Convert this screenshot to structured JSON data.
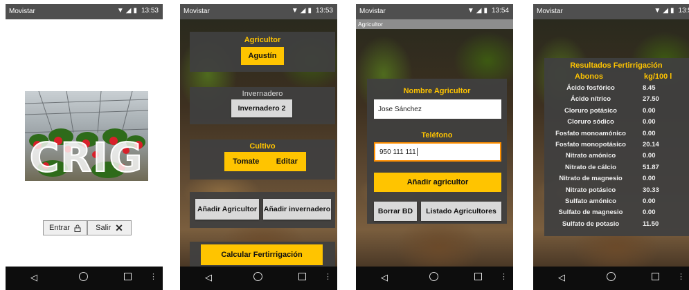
{
  "screen1": {
    "status": {
      "carrier": "Movistar",
      "time": "13:53"
    },
    "logo_text": "CRIG",
    "enter_label": "Entrar",
    "exit_label": "Salir"
  },
  "screen2": {
    "status": {
      "carrier": "Movistar",
      "time": "13:53"
    },
    "farmer_label": "Agricultor",
    "farmer_value": "Agustín",
    "greenhouse_label": "Invernadero",
    "greenhouse_value": "Invernadero 2",
    "crop_label": "Cultivo",
    "crop_value": "Tomate",
    "edit_label": "Editar",
    "add_farmer_label": "Añadir Agricultor",
    "add_greenhouse_label": "Añadir invernadero",
    "calc_label": "Calcular Fertirrigación"
  },
  "screen3": {
    "status": {
      "carrier": "Movistar",
      "time": "13:54"
    },
    "window_title": "Agricultor",
    "name_label": "Nombre Agricultor",
    "name_value": "Jose Sánchez",
    "phone_label": "Teléfono",
    "phone_value": "950 111 111",
    "add_label": "Añadir agricultor",
    "delete_db_label": "Borrar BD",
    "list_label": "Listado Agricultores"
  },
  "screen4": {
    "status": {
      "carrier": "Movistar",
      "time": "13:5"
    },
    "title": "Resultados Fertirrigación",
    "col_fertilizer": "Abonos",
    "col_unit": "kg/100 l",
    "rows": [
      {
        "name": "Ácido fosfórico",
        "value": "8.45"
      },
      {
        "name": "Ácido nítrico",
        "value": "27.50"
      },
      {
        "name": "Cloruro potásico",
        "value": "0.00"
      },
      {
        "name": "Cloruro sódico",
        "value": "0.00"
      },
      {
        "name": "Fosfato monoamónico",
        "value": "0.00"
      },
      {
        "name": "Fosfato monopotásico",
        "value": "20.14"
      },
      {
        "name": "Nitrato amónico",
        "value": "0.00"
      },
      {
        "name": "Nitrato de cálcio",
        "value": "51.87"
      },
      {
        "name": "Nitrato de magnesio",
        "value": "0.00"
      },
      {
        "name": "Nitrato potásico",
        "value": "30.33"
      },
      {
        "name": "Sulfato amónico",
        "value": "0.00"
      },
      {
        "name": "Sulfato de magnesio",
        "value": "0.00"
      },
      {
        "name": "Sulfato de potasio",
        "value": "11.50"
      }
    ]
  },
  "colors": {
    "accent": "#ffc400",
    "panel": "#404040",
    "statusbar": "#4f4f4f",
    "navbar": "#0d0d0d"
  },
  "icons": {
    "lock": "lock-icon",
    "close": "close-icon",
    "back": "back-icon",
    "home": "home-icon",
    "recents": "recents-icon"
  }
}
